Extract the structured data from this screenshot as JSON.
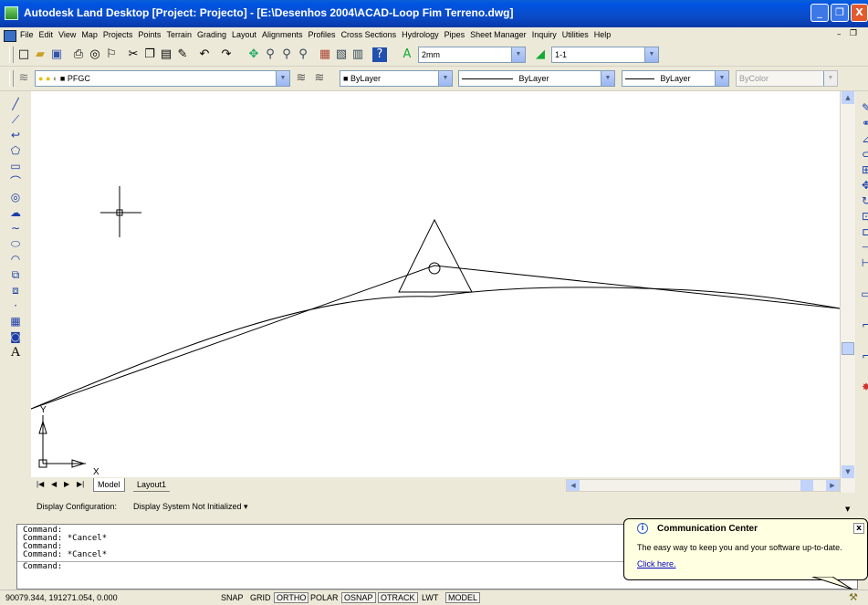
{
  "window": {
    "title": "Autodesk Land Desktop [Project: Projecto] - [E:\\Desenhos 2004\\ACAD-Loop Fim Terreno.dwg]",
    "minimize_glyph": "_",
    "maximize_glyph": "❐",
    "close_glyph": "X"
  },
  "menu": [
    "File",
    "Edit",
    "View",
    "Map",
    "Projects",
    "Points",
    "Terrain",
    "Grading",
    "Layout",
    "Alignments",
    "Profiles",
    "Cross Sections",
    "Hydrology",
    "Pipes",
    "Sheet Manager",
    "Inquiry",
    "Utilities",
    "Help"
  ],
  "standard_toolbar": {
    "text_height": "2mm",
    "scale": "1-1"
  },
  "properties_toolbar": {
    "layer": "PFGC",
    "color": "ByLayer",
    "linetype": "ByLayer",
    "lineweight": "ByLayer",
    "plotstyle": "ByColor"
  },
  "draw_toolbar": {
    "text_tool_glyph": "A"
  },
  "ucs": {
    "y_label": "Y",
    "x_label": "X"
  },
  "tabs": {
    "model": "Model",
    "layout": "Layout1"
  },
  "display_config": {
    "label": "Display Configuration:",
    "value": "Display System Not Initialized ▾"
  },
  "command": {
    "lines": [
      "Command:",
      "Command:  *Cancel*",
      "Command:",
      "Command:  *Cancel*"
    ],
    "prompt": "Command:"
  },
  "balloon": {
    "title": "Communication Center",
    "body": "The easy way to keep you and your software up-to-date.",
    "link": "Click here.",
    "close_glyph": "x",
    "info_glyph": "i"
  },
  "status": {
    "coords": "90079.344, 191271.054, 0.000",
    "buttons": [
      "SNAP",
      "GRID",
      "ORTHO",
      "POLAR",
      "OSNAP",
      "OTRACK",
      "LWT",
      "MODEL"
    ],
    "pressed": [
      "ORTHO",
      "OSNAP",
      "OTRACK",
      "MODEL"
    ]
  },
  "colors": {
    "titlebar": "#0a4bc8",
    "window_bg": "#ece9d8",
    "canvas": "#ffffff",
    "balloon": "#ffffe1",
    "link": "#0000cc"
  },
  "icons": {
    "left": [
      "line-icon",
      "construction-line-icon",
      "polyline-icon",
      "polygon-icon",
      "rectangle-icon",
      "arc-icon",
      "circle-icon",
      "revision-cloud-icon",
      "spline-icon",
      "ellipse-icon",
      "ellipse-arc-icon",
      "insert-block-icon",
      "make-block-icon",
      "point-icon",
      "hatch-icon",
      "region-icon",
      "multiline-text-icon"
    ],
    "right": [
      "erase-icon",
      "copy-icon",
      "mirror-icon",
      "offset-icon",
      "array-icon",
      "move-icon",
      "rotate-icon",
      "scale-icon",
      "stretch-icon",
      "trim-icon",
      "extend-icon",
      "break-icon",
      "chamfer-icon",
      "fillet-icon",
      "explode-icon"
    ]
  }
}
